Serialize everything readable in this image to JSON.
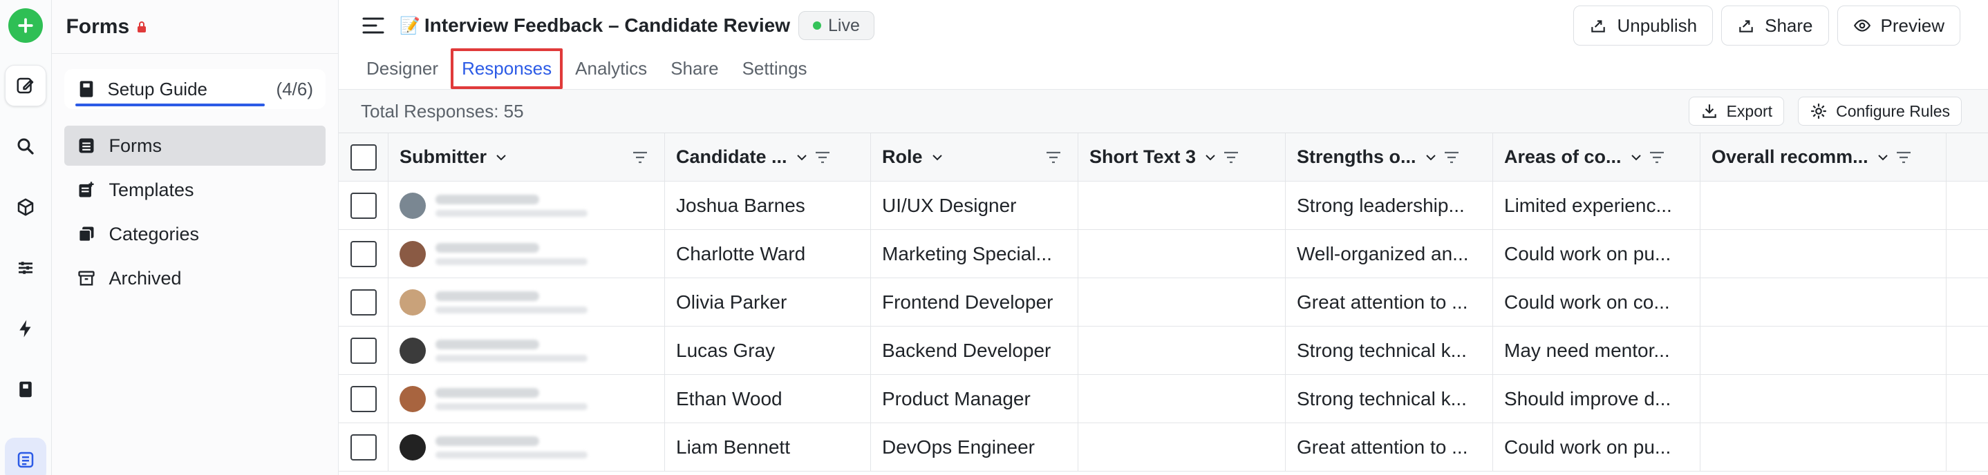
{
  "sidebar": {
    "title": "Forms",
    "guide": {
      "label": "Setup Guide",
      "count": "(4/6)"
    },
    "items": [
      {
        "label": "Forms",
        "icon": "table-icon"
      },
      {
        "label": "Templates",
        "icon": "template-icon"
      },
      {
        "label": "Categories",
        "icon": "categories-icon"
      },
      {
        "label": "Archived",
        "icon": "archive-icon"
      }
    ]
  },
  "header": {
    "emoji": "📝",
    "title": "Interview Feedback – Candidate Review",
    "status": "Live",
    "actions": {
      "unpublish": "Unpublish",
      "share": "Share",
      "preview": "Preview"
    }
  },
  "tabs": [
    "Designer",
    "Responses",
    "Analytics",
    "Share",
    "Settings"
  ],
  "active_tab": "Responses",
  "subbar": {
    "total": "Total Responses: 55",
    "export": "Export",
    "configure": "Configure Rules"
  },
  "table": {
    "columns": [
      "Submitter",
      "Candidate ...",
      "Role",
      "Short Text 3",
      "Strengths o...",
      "Areas of co...",
      "Overall recomm..."
    ],
    "rows": [
      {
        "candidate": "Joshua Barnes",
        "role": "UI/UX Designer",
        "short": "",
        "strengths": "Strong leadership...",
        "areas": "Limited experienc...",
        "overall": "",
        "avatar_color": "#7a8792"
      },
      {
        "candidate": "Charlotte Ward",
        "role": "Marketing Special...",
        "short": "",
        "strengths": "Well-organized an...",
        "areas": "Could work on pu...",
        "overall": "",
        "avatar_color": "#8a5a44"
      },
      {
        "candidate": "Olivia Parker",
        "role": "Frontend Developer",
        "short": "",
        "strengths": "Great attention to ...",
        "areas": "Could work on co...",
        "overall": "",
        "avatar_color": "#c9a27a"
      },
      {
        "candidate": "Lucas Gray",
        "role": "Backend Developer",
        "short": "",
        "strengths": "Strong technical k...",
        "areas": "May need mentor...",
        "overall": "",
        "avatar_color": "#3b3b3b"
      },
      {
        "candidate": "Ethan Wood",
        "role": "Product Manager",
        "short": "",
        "strengths": "Strong technical k...",
        "areas": "Should improve d...",
        "overall": "",
        "avatar_color": "#a8643f"
      },
      {
        "candidate": "Liam Bennett",
        "role": "DevOps Engineer",
        "short": "",
        "strengths": "Great attention to ...",
        "areas": "Could work on pu...",
        "overall": "",
        "avatar_color": "#222222"
      }
    ]
  },
  "colors": {
    "accent": "#2c5be6",
    "brand_green": "#2fbf55",
    "highlight_red": "#e03a3a"
  }
}
